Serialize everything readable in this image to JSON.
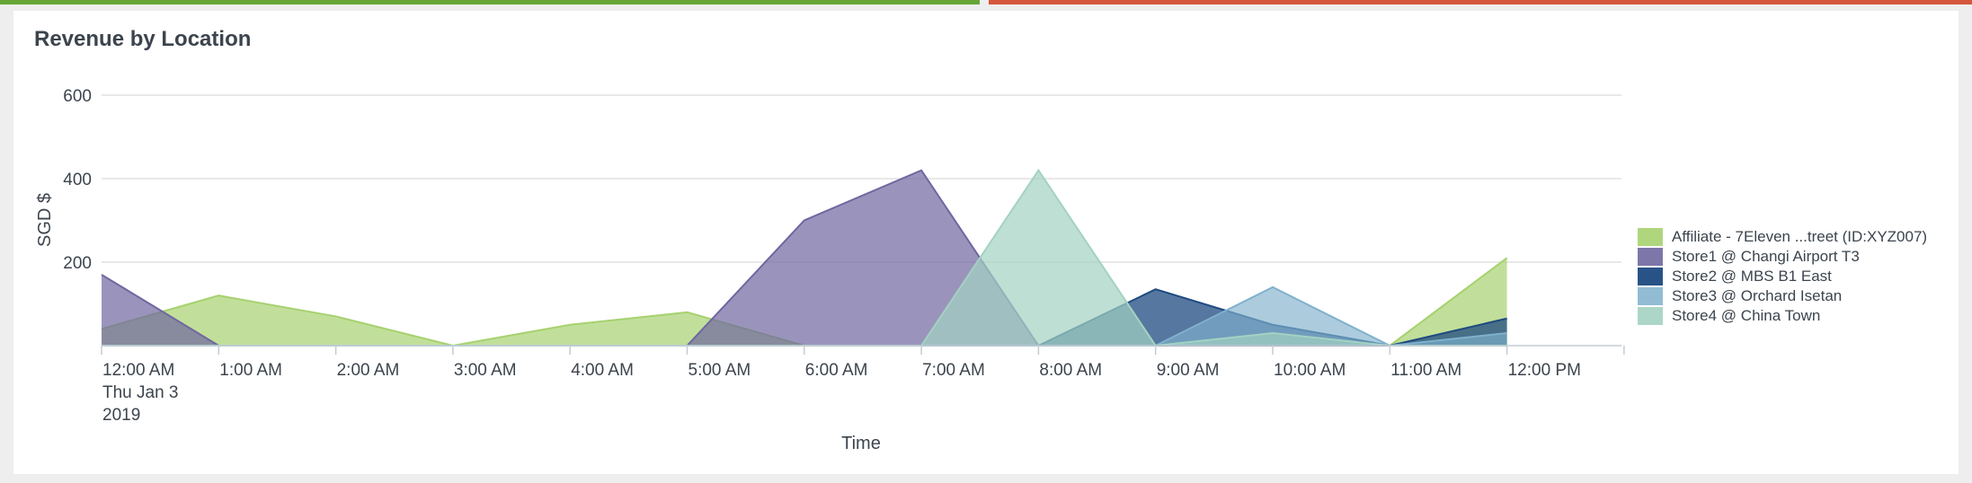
{
  "panel": {
    "title": "Revenue by Location"
  },
  "colors": {
    "top_bar_left": "#65a637",
    "top_bar_right": "#d6563c"
  },
  "chart_data": {
    "type": "area",
    "title": "Revenue by Location",
    "xlabel": "Time",
    "ylabel": "SGD $",
    "ylim": [
      0,
      600
    ],
    "yticks": [
      200,
      400,
      600
    ],
    "grid": true,
    "legend_position": "right",
    "x": [
      "12:00 AM",
      "1:00 AM",
      "2:00 AM",
      "3:00 AM",
      "4:00 AM",
      "5:00 AM",
      "6:00 AM",
      "7:00 AM",
      "8:00 AM",
      "9:00 AM",
      "10:00 AM",
      "11:00 AM",
      "12:00 PM"
    ],
    "x_tick_labels": [
      "12:00 AM",
      "1:00 AM",
      "2:00 AM",
      "3:00 AM",
      "4:00 AM",
      "5:00 AM",
      "6:00 AM",
      "7:00 AM",
      "8:00 AM",
      "9:00 AM",
      "10:00 AM",
      "11:00 AM",
      "12:00 PM"
    ],
    "x_first_label_extra": [
      "Thu Jan 3",
      "2019"
    ],
    "series": [
      {
        "name": "Affiliate - 7Eleven ...treet (ID:XYZ007)",
        "color": "#a6d16f",
        "opacity": 0.7,
        "values": [
          40,
          120,
          70,
          0,
          50,
          80,
          0,
          0,
          0,
          0,
          0,
          0,
          210
        ]
      },
      {
        "name": "Store1 @ Changi Airport T3",
        "color": "#6f67a0",
        "opacity": 0.7,
        "values": [
          170,
          0,
          0,
          0,
          0,
          0,
          300,
          420,
          0,
          0,
          0,
          0,
          0
        ]
      },
      {
        "name": "Store2 @ MBS B1 East",
        "color": "#1e4a80",
        "opacity": 0.75,
        "values": [
          0,
          0,
          0,
          0,
          0,
          0,
          0,
          0,
          0,
          135,
          50,
          0,
          65
        ]
      },
      {
        "name": "Store3 @ Orchard Isetan",
        "color": "#7fb0cd",
        "opacity": 0.65,
        "values": [
          0,
          0,
          0,
          0,
          0,
          0,
          0,
          0,
          0,
          0,
          140,
          0,
          30
        ]
      },
      {
        "name": "Store4 @ China Town",
        "color": "#a3d2c2",
        "opacity": 0.7,
        "values": [
          0,
          0,
          0,
          0,
          0,
          0,
          0,
          0,
          420,
          0,
          30,
          0,
          0
        ]
      }
    ]
  }
}
